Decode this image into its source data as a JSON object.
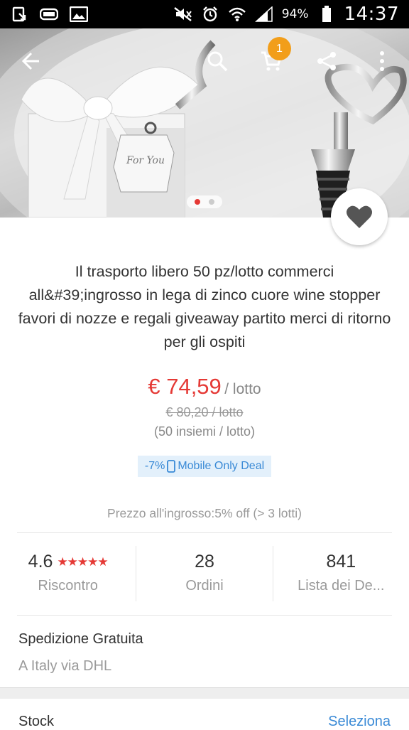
{
  "status_bar": {
    "battery": "94%",
    "time": "14:37"
  },
  "header": {
    "cart_badge": "1"
  },
  "product": {
    "title": "Il trasporto libero 50 pz/lotto commerci all&#39;ingrosso in lega di zinco cuore wine stopper favori di nozze e regali giveaway partito merci di ritorno per gli ospiti",
    "price": "€ 74,59",
    "price_unit": "/ lotto",
    "old_price": "€ 80,20 / lotto",
    "pack": "(50 insiemi / lotto)",
    "deal_percent": "-7%",
    "deal_label": "Mobile Only Deal",
    "wholesale": "Prezzo all'ingrosso:5% off (> 3 lotti)",
    "tag_text": "For You"
  },
  "stats": {
    "rating_value": "4.6",
    "rating_stars": "★★★★★",
    "rating_label": "Riscontro",
    "orders_value": "28",
    "orders_label": "Ordini",
    "wishlist_value": "841",
    "wishlist_label": "Lista dei De..."
  },
  "shipping": {
    "title": "Spedizione Gratuita",
    "sub": "A Italy via DHL"
  },
  "stock": {
    "label": "Stock",
    "action": "Seleziona"
  },
  "colors": {
    "price_red": "#e53935",
    "link_blue": "#3a8ad6",
    "badge_orange": "#f29e1a"
  }
}
